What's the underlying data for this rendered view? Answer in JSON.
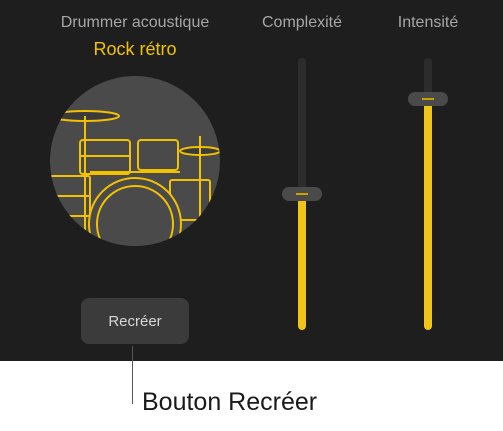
{
  "drummer": {
    "name": "Drummer acoustique",
    "style": "Rock rétro"
  },
  "sliders": {
    "complexity": {
      "label": "Complexité",
      "value": 0.5
    },
    "intensity": {
      "label": "Intensité",
      "value": 0.85
    }
  },
  "regenerate_button": {
    "label": "Recréer"
  },
  "callout": {
    "text": "Bouton Recréer"
  },
  "colors": {
    "accent": "#f0c419",
    "panel": "#1e1e1e"
  }
}
